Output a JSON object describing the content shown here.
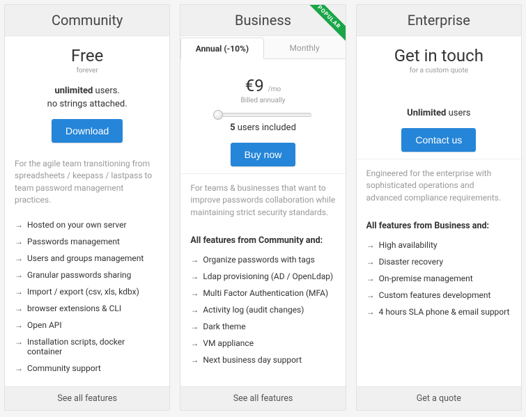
{
  "community": {
    "title": "Community",
    "price": "Free",
    "sub": "forever",
    "line1_bold": "unlimited",
    "line1_rest": " users.",
    "line2": "no strings attached.",
    "button": "Download",
    "desc": "For the agile team transitioning from spreadsheets / keepass / lastpass to team password management practices.",
    "features": [
      "Hosted on your own server",
      "Passwords management",
      "Users and groups management",
      "Granular passwords sharing",
      "Import / export (csv, xls, kdbx)",
      "browser extensions & CLI",
      "Open API",
      "Installation scripts, docker container",
      "Community support"
    ],
    "footer": "See all features"
  },
  "business": {
    "title": "Business",
    "ribbon": "POPULAR",
    "tab_annual": "Annual (-10%)",
    "tab_monthly": "Monthly",
    "price": "€9",
    "per": "/mo",
    "billed": "Billed annually",
    "users_bold": "5",
    "users_rest": " users included",
    "button": "Buy now",
    "desc": "For teams & businesses that want to improve passwords collaboration while maintaining strict security standards.",
    "feat_head": "All features from Community and:",
    "features": [
      "Organize passwords with tags",
      "Ldap provisioning (AD / OpenLdap)",
      "Multi Factor Authentication (MFA)",
      "Activity log (audit changes)",
      "Dark theme",
      "VM appliance",
      "Next business day support"
    ],
    "footer": "See all features"
  },
  "enterprise": {
    "title": "Enterprise",
    "price": "Get in touch",
    "sub": "for a custom quote",
    "users_bold": "Unlimited",
    "users_rest": " users",
    "button": "Contact us",
    "desc": "Engineered for the enterprise with sophisticated operations and advanced compliance requirements.",
    "feat_head": "All features from Business and:",
    "features": [
      "High availability",
      "Disaster recovery",
      "On-premise management",
      "Custom features development",
      "4 hours SLA phone & email support"
    ],
    "footer": "Get a quote"
  }
}
